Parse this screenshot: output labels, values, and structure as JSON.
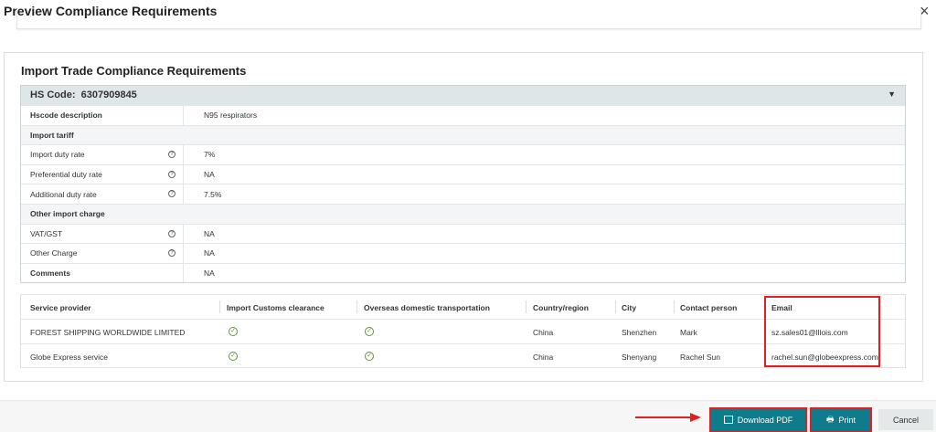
{
  "dialog": {
    "title": "Preview Compliance Requirements",
    "close": "×"
  },
  "section": {
    "title": "Import Trade Compliance Requirements"
  },
  "hs": {
    "label": "HS Code:",
    "code": "6307909845",
    "description_label": "Hscode description",
    "description": "N95 respirators",
    "import_tariff": "Import tariff",
    "import_duty_label": "Import duty rate",
    "import_duty": "7%",
    "pref_duty_label": "Preferential duty rate",
    "pref_duty": "NA",
    "add_duty_label": "Additional duty rate",
    "add_duty": "7.5%",
    "other_charge_group": "Other import charge",
    "vat_label": "VAT/GST",
    "vat": "NA",
    "other_label": "Other Charge",
    "other": "NA",
    "comments_label": "Comments",
    "comments": "NA"
  },
  "providers": {
    "headers": [
      "Service provider",
      "Import Customs clearance",
      "Overseas domestic transportation",
      "Country/region",
      "City",
      "Contact person",
      "Email"
    ],
    "rows": [
      {
        "name": "FOREST SHIPPING WORLDWIDE LIMITED",
        "customs": true,
        "transport": true,
        "country": "China",
        "city": "Shenzhen",
        "contact": "Mark",
        "email": "sz.sales01@lllois.com"
      },
      {
        "name": "Globe Express service",
        "customs": true,
        "transport": true,
        "country": "China",
        "city": "Shenyang",
        "contact": "Rachel Sun",
        "email": "rachel.sun@globeexpress.com"
      }
    ]
  },
  "footer": {
    "download": "Download PDF",
    "print": "Print",
    "cancel": "Cancel"
  },
  "colors": {
    "accent": "#0e7c8c",
    "highlight": "#e02020"
  }
}
